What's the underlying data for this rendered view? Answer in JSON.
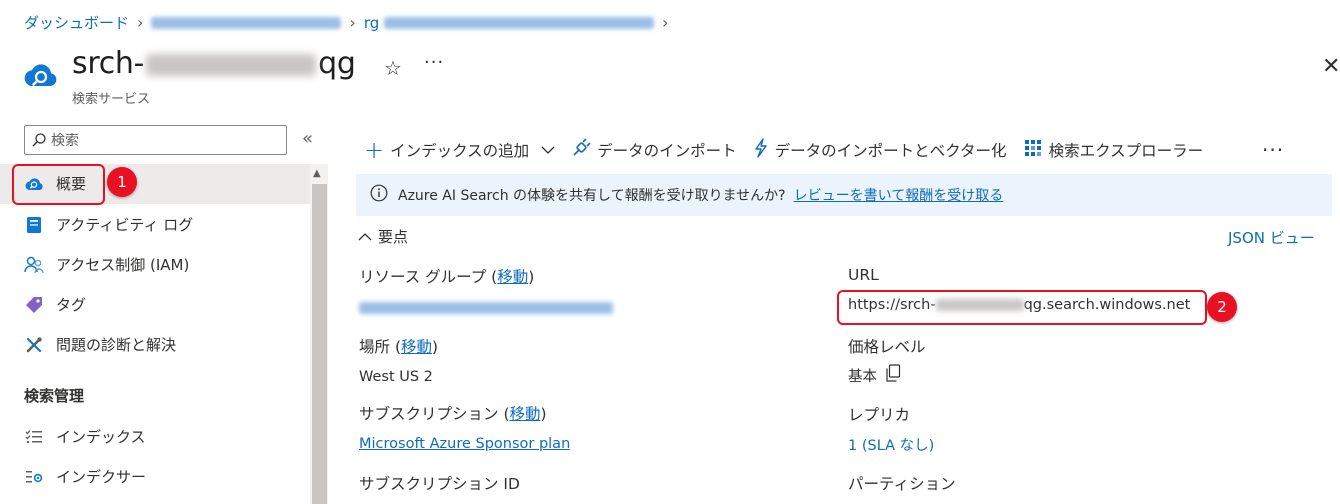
{
  "breadcrumb": {
    "home": "ダッシュボード",
    "rg_prefix": "rg"
  },
  "header": {
    "title_start": "srch-",
    "title_end": "qg",
    "subtitle": "検索サービス"
  },
  "sidebar": {
    "search_placeholder": "検索",
    "items": [
      {
        "label": "概要",
        "icon": "search-service-icon"
      },
      {
        "label": "アクティビティ ログ",
        "icon": "activity-log-icon"
      },
      {
        "label": "アクセス制御 (IAM)",
        "icon": "iam-icon"
      },
      {
        "label": "タグ",
        "icon": "tag-icon"
      },
      {
        "label": "問題の診断と解決",
        "icon": "wrench-icon"
      }
    ],
    "section_title": "検索管理",
    "section_items": [
      {
        "label": "インデックス",
        "icon": "index-list-icon"
      },
      {
        "label": "インデクサー",
        "icon": "indexer-icon"
      }
    ]
  },
  "toolbar": {
    "add_index": "インデックスの追加",
    "import_data": "データのインポート",
    "import_vectorize": "データのインポートとベクター化",
    "search_explorer": "検索エクスプローラー"
  },
  "banner": {
    "text": "Azure AI Search の体験を共有して報酬を受け取りませんか?",
    "link": "レビューを書いて報酬を受け取る"
  },
  "essentials": {
    "title": "要点",
    "json_view": "JSON ビュー",
    "move": "移動",
    "resource_group_label": "リソース グループ",
    "location_label": "場所",
    "location_value": "West US 2",
    "subscription_label": "サブスクリプション",
    "subscription_value": "Microsoft Azure Sponsor plan",
    "subscription_id_label": "サブスクリプション ID",
    "url_label": "URL",
    "url_start": "https://srch-",
    "url_end": "qg.search.windows.net",
    "pricing_label": "価格レベル",
    "pricing_value": "基本",
    "replica_label": "レプリカ",
    "replica_value": "1 (SLA なし)",
    "partition_label": "パーティション"
  },
  "annotations": [
    "1",
    "2"
  ],
  "colors": {
    "accent": "#0f6cbd",
    "annotation_red": "#e81123",
    "banner_bg": "#ebf3fc",
    "selected_bg": "#edebe9"
  }
}
